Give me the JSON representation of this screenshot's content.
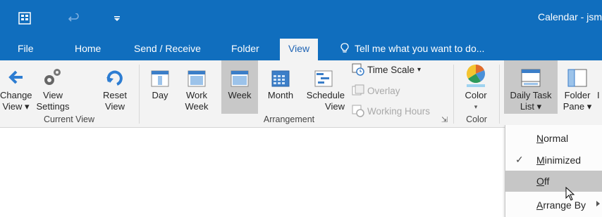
{
  "window": {
    "title": "Calendar - jsm"
  },
  "tabs": [
    {
      "label": "File"
    },
    {
      "label": "Home"
    },
    {
      "label": "Send / Receive"
    },
    {
      "label": "Folder"
    },
    {
      "label": "View"
    }
  ],
  "tell_me": "Tell me what you want to do...",
  "ribbon": {
    "current_view": {
      "group_label": "Current View",
      "change_view": {
        "line1": "Change",
        "line2": "View"
      },
      "view_settings": {
        "line1": "View",
        "line2": "Settings"
      },
      "reset_view": {
        "line1": "Reset",
        "line2": "View"
      }
    },
    "arrangement": {
      "group_label": "Arrangement",
      "day": "Day",
      "work_week": {
        "line1": "Work",
        "line2": "Week"
      },
      "week": "Week",
      "month": "Month",
      "schedule_view": {
        "line1": "Schedule",
        "line2": "View"
      },
      "time_scale": "Time Scale",
      "overlay": "Overlay",
      "working_hours": "Working Hours"
    },
    "color": {
      "group_label": "Color",
      "button": "Color"
    },
    "layout": {
      "daily_task_list": {
        "line1": "Daily Task",
        "line2": "List"
      },
      "folder_pane": {
        "line1": "Folder",
        "line2": "Pane"
      },
      "cut_off_letter": "I"
    }
  },
  "menu": {
    "items": [
      {
        "label_prefix": "",
        "accel": "N",
        "label_rest": "ormal",
        "checked": false
      },
      {
        "label_prefix": "",
        "accel": "M",
        "label_rest": "inimized",
        "checked": true
      },
      {
        "label_prefix": "",
        "accel": "O",
        "label_rest": "ff",
        "checked": false,
        "hovered": true
      },
      {
        "label_prefix": "",
        "accel": "A",
        "label_rest": "rrange By",
        "checked": false,
        "submenu": true
      }
    ],
    "check_glyph": "✓"
  },
  "colors": {
    "titlebar": "#106ebe",
    "ribbon": "#f3f3f3",
    "selected": "#c8c8c8",
    "accent_blue": "#1e63b4"
  }
}
